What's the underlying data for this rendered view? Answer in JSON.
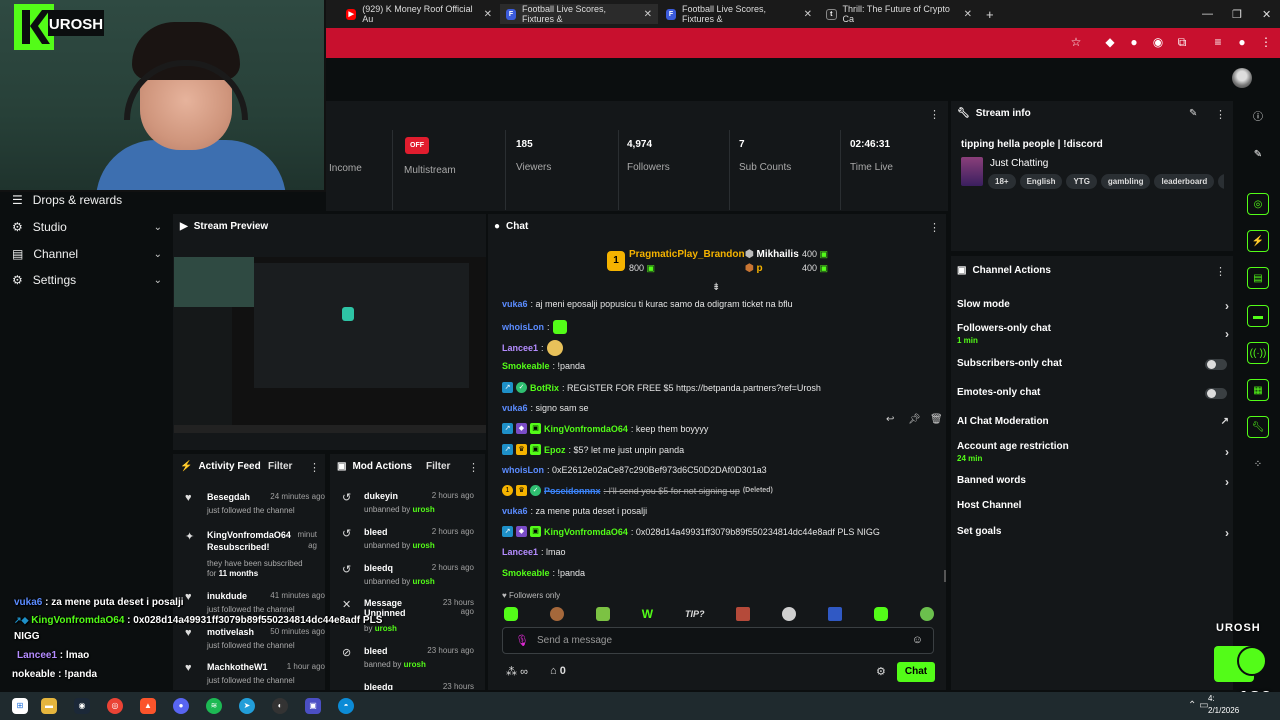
{
  "browser": {
    "tabs": [
      {
        "label": "(929) K Money Roof Official Au",
        "fav": "▶",
        "color": "#ff0000"
      },
      {
        "label": "Football Live Scores, Fixtures &",
        "fav": "F",
        "color": "#3b5bdb"
      },
      {
        "label": "Football Live Scores, Fixtures &",
        "fav": "F",
        "color": "#3b5bdb"
      },
      {
        "label": "Thrill: The Future of Crypto Ca",
        "fav": "t",
        "color": "#222"
      }
    ],
    "new_tab": "+"
  },
  "overlay": {
    "logo_text": "UROSH"
  },
  "nav": {
    "items": [
      {
        "label": "Drops & rewards",
        "icon": "drops-icon",
        "glyph": "☰"
      },
      {
        "label": "Studio",
        "icon": "studio-icon",
        "glyph": "⚙"
      },
      {
        "label": "Channel",
        "icon": "channel-icon",
        "glyph": "▤"
      },
      {
        "label": "Settings",
        "icon": "settings-icon",
        "glyph": "⚙"
      }
    ]
  },
  "stats": {
    "income_label": "Income",
    "multistream_badge": "OFF",
    "multistream_label": "Multistream",
    "viewers": "185",
    "viewers_label": "Viewers",
    "followers": "4,974",
    "followers_label": "Followers",
    "subs": "7",
    "subs_label": "Sub Counts",
    "time": "02:46:31",
    "time_label": "Time Live"
  },
  "preview": {
    "title": "Stream Preview"
  },
  "activity": {
    "title": "Activity Feed",
    "filter": "Filter",
    "items": [
      {
        "name": "Besegdah",
        "time": "24 minutes ago",
        "sub": "just followed the channel"
      },
      {
        "name": "KingVonfromdaO64",
        "name2": "Resubscribed!",
        "time": "minut",
        "time2": "ag",
        "sub": "they have been subscribed",
        "sub2": "for",
        "months": "11 months"
      },
      {
        "name": "inukdude",
        "time": "41 minutes ago",
        "sub": "just followed the channel"
      },
      {
        "name": "motivelash",
        "time": "50 minutes ago",
        "sub": "just followed the channel"
      },
      {
        "name": "MachkotheW1",
        "time": "1 hour ago",
        "sub": "just followed the channel"
      }
    ]
  },
  "modactions": {
    "title": "Mod Actions",
    "filter": "Filter",
    "items": [
      {
        "name": "dukeyin",
        "time": "2 hours ago",
        "sub": "unbanned by",
        "by": "urosh"
      },
      {
        "name": "bleed",
        "time": "2 hours ago",
        "sub": "unbanned by",
        "by": "urosh"
      },
      {
        "name": "bleedq",
        "time": "2 hours ago",
        "sub": "unbanned by",
        "by": "urosh"
      },
      {
        "name": "Message Unpinned",
        "time": "23 hours ago",
        "sub": "by",
        "by": "urosh"
      },
      {
        "name": "bleed",
        "time": "23 hours ago",
        "sub": "banned by",
        "by": "urosh"
      },
      {
        "name": "bleedq",
        "time": "23 hours",
        "sub": "",
        "by": ""
      }
    ]
  },
  "chat": {
    "title": "Chat",
    "leaderboard": [
      {
        "rank": "1",
        "name": "PragmaticPlay_Brandon",
        "amount": "800"
      },
      {
        "name": "Mikhailis",
        "amount": "400"
      },
      {
        "name": "p",
        "amount": "400"
      }
    ],
    "messages": [
      {
        "user": "vuka6",
        "color": "#5b8cff",
        "text": ": aj meni eposalji popusicu ti kurac samo da odigram ticket na bflu"
      },
      {
        "user": "whoisLon",
        "color": "#5b8cff",
        "text": ":"
      },
      {
        "user": "Lancee1",
        "color": "#b48cff",
        "text": ":"
      },
      {
        "user": "Smokeable",
        "color": "#53fc18",
        "text": ": !panda"
      },
      {
        "user": "BotRix",
        "color": "#53fc18",
        "text": ": REGISTER FOR FREE $5 https://betpanda.partners?ref=Urosh"
      },
      {
        "user": "vuka6",
        "color": "#5b8cff",
        "text": ": signo sam se"
      },
      {
        "user": "KingVonfromdaO64",
        "color": "#53fc18",
        "text": ": keep them boyyyy"
      },
      {
        "user": "Epoz",
        "color": "#53fc18",
        "text": ": $5? let me just unpin panda"
      },
      {
        "user": "whoisLon",
        "color": "#5b8cff",
        "text": ": 0xE2612e02aCe87c290Bef973d6C50D2DAf0D301a3"
      },
      {
        "user": "Poseidonnnx",
        "color": "#3b82f6",
        "text": ": I'll send you $5 for not signing up",
        "deleted": "(Deleted)"
      },
      {
        "user": "vuka6",
        "color": "#5b8cff",
        "text": ": za mene puta deset i posalji"
      },
      {
        "user": "KingVonfromdaO64",
        "color": "#53fc18",
        "text": ": 0x028d14a49931ff3079b89f550234814dc44e8adf PLS NIGG"
      },
      {
        "user": "Lancee1",
        "color": "#b48cff",
        "text": ": lmao"
      },
      {
        "user": "Smokeable",
        "color": "#53fc18",
        "text": ": !panda"
      }
    ],
    "followers_only": "Followers only",
    "emote_bar": [
      "",
      "",
      "",
      "W",
      "TIP?",
      "",
      "",
      "",
      "",
      ""
    ],
    "placeholder": "Send a message",
    "points_label": "∞",
    "zero": "0",
    "send": "Chat"
  },
  "streaminfo": {
    "title": "Stream info",
    "stream_title": "tipping hella people | !discord",
    "category": "Just Chatting",
    "tags": [
      "18+",
      "English",
      "YTG",
      "gambling",
      "leaderboard",
      "tip"
    ]
  },
  "channelactions": {
    "title": "Channel Actions",
    "rows": [
      {
        "label": "Slow mode",
        "right": "›"
      },
      {
        "label": "Followers-only chat",
        "sub": "1 min",
        "right": "›"
      },
      {
        "label": "Subscribers-only chat"
      },
      {
        "label": "Emotes-only chat"
      },
      {
        "label": "AI Chat Moderation",
        "right": "↗"
      },
      {
        "label": "Account age restriction",
        "sub": "24 min",
        "right": "›"
      },
      {
        "label": "Banned words",
        "right": "›"
      },
      {
        "label": "Host Channel"
      },
      {
        "label": "Set goals",
        "right": "›"
      }
    ]
  },
  "overlay_chat": [
    {
      "user": "vuka6",
      "color": "#5b8cff",
      "text": " : za mene puta deset i posalji"
    },
    {
      "user": "KingVonfromdaO64",
      "color": "#53fc18",
      "text": " : 0x028d14a49931ff3079b89f550234814dc44e8adf PLS"
    },
    {
      "user": "",
      "color": "#ffffff",
      "text": "NIGG"
    },
    {
      "user": "Lancee1",
      "color": "#b48cff",
      "text": " : lmao"
    },
    {
      "user": "",
      "color": "#ffffff",
      "text": "nokeable : !panda"
    }
  ],
  "viewer_overlay": {
    "count": "186",
    "brand": "UROSH"
  },
  "taskbar": {
    "time": "4:",
    "date": "2/1/2026"
  }
}
